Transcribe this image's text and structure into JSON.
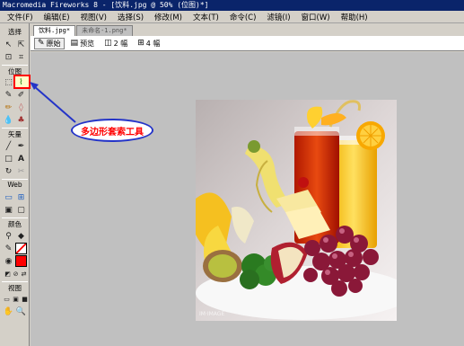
{
  "window": {
    "title": "Macromedia Fireworks 8 - [饮料.jpg @ 50% (位图)*]"
  },
  "menu": [
    "文件(F)",
    "编辑(E)",
    "视图(V)",
    "选择(S)",
    "修改(M)",
    "文本(T)",
    "命令(C)",
    "滤镜(I)",
    "窗口(W)",
    "帮助(H)"
  ],
  "tools": {
    "sections": {
      "select": "选择",
      "bitmap": "位图",
      "vector": "矢量",
      "web": "Web",
      "colors": "颜色",
      "view": "视图"
    }
  },
  "document": {
    "tabs": [
      "饮料.jpg*",
      "未命名-1.png*"
    ],
    "view_buttons": [
      "原始",
      "预览",
      "2 幅",
      "4 幅"
    ]
  },
  "annotation": {
    "label": "多边形套索工具"
  },
  "colors": {
    "highlight": "#ff0000",
    "callout_border": "#2434c8",
    "callout_text": "#ff0000",
    "titlebar": "#0a246a"
  }
}
